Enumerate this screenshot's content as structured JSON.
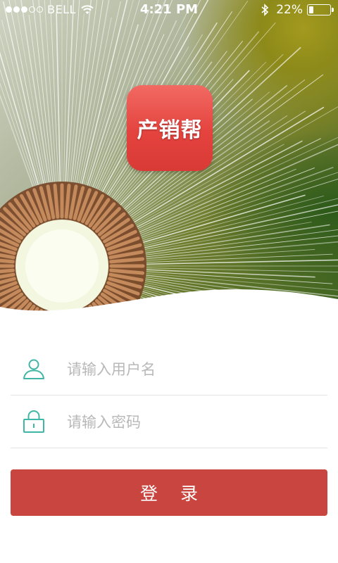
{
  "status_bar": {
    "carrier": "BELL",
    "time": "4:21 PM",
    "battery_percent": "22%",
    "battery_level": 0.22,
    "signal_strength": 3,
    "signal_max": 5
  },
  "app": {
    "logo_text": "产销帮",
    "brand_color": "#e4433e"
  },
  "login_form": {
    "username_placeholder": "请输入用户名",
    "username_value": "",
    "password_placeholder": "请输入密码",
    "password_value": "",
    "submit_label": "登 录",
    "icon_color": "#3fb7a4",
    "button_color": "#c9453f"
  }
}
